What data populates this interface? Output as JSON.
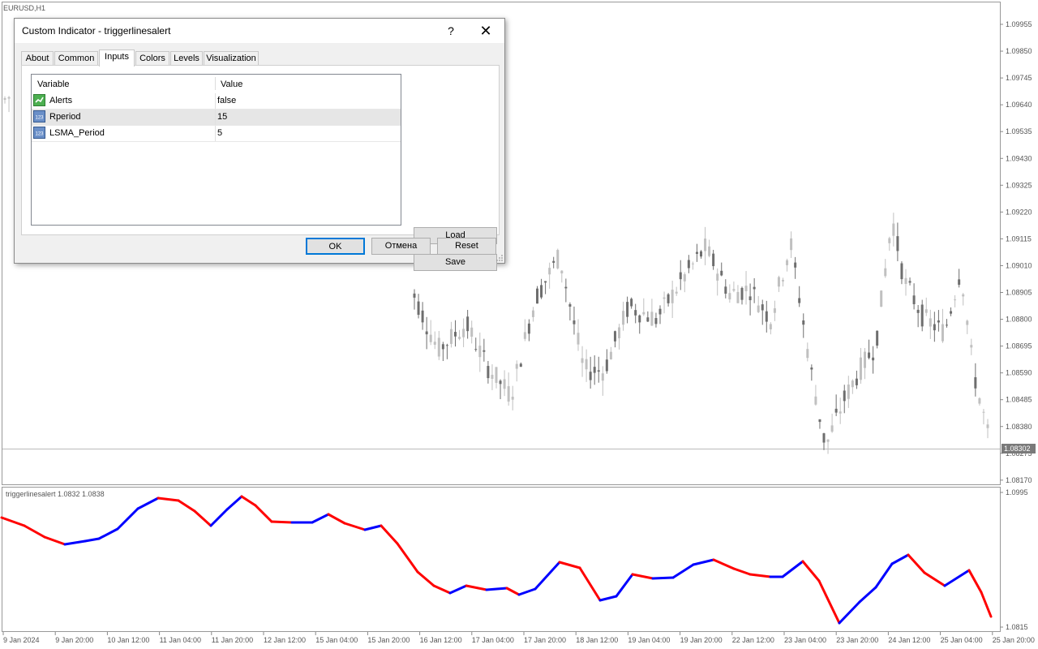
{
  "chart": {
    "symbol_label": "EURUSD,H1",
    "price_ticks": [
      "1.09955",
      "1.09850",
      "1.09745",
      "1.09640",
      "1.09535",
      "1.09430",
      "1.09325",
      "1.09220",
      "1.09115",
      "1.09010",
      "1.08905",
      "1.08800",
      "1.08695",
      "1.08590",
      "1.08485",
      "1.08380",
      "1.08275",
      "1.08170"
    ],
    "current_price": "1.08302",
    "current_price_color": "#7a7a7a",
    "indicator_label": "triggerlinesalert 1.0832 1.0838",
    "indicator_ticks": [
      "1.0995",
      "1.0815"
    ],
    "time_labels": [
      "9 Jan 2024",
      "9 Jan 20:00",
      "10 Jan 12:00",
      "11 Jan 04:00",
      "11 Jan 20:00",
      "12 Jan 12:00",
      "15 Jan 04:00",
      "15 Jan 20:00",
      "16 Jan 12:00",
      "17 Jan 04:00",
      "17 Jan 20:00",
      "18 Jan 12:00",
      "19 Jan 04:00",
      "19 Jan 20:00",
      "22 Jan 12:00",
      "23 Jan 04:00",
      "23 Jan 20:00",
      "24 Jan 12:00",
      "25 Jan 04:00",
      "25 Jan 20:00"
    ],
    "colors": {
      "bull": "#c0c0c0",
      "bear": "#6e6e6e",
      "line_up": "#0000ff",
      "line_down": "#ff0000"
    }
  },
  "dialog": {
    "title": "Custom Indicator - triggerlinesalert",
    "help_label": "?",
    "close_label": "✕",
    "tabs": [
      {
        "label": "About"
      },
      {
        "label": "Common"
      },
      {
        "label": "Inputs"
      },
      {
        "label": "Colors"
      },
      {
        "label": "Levels"
      },
      {
        "label": "Visualization"
      }
    ],
    "active_tab": "Inputs",
    "grid": {
      "col_variable": "Variable",
      "col_value": "Value",
      "rows": [
        {
          "name": "Alerts",
          "value": "false",
          "icon": "toggle-icon"
        },
        {
          "name": "Rperiod",
          "value": "15",
          "icon": "number-icon"
        },
        {
          "name": "LSMA_Period",
          "value": "5",
          "icon": "number-icon"
        }
      ]
    },
    "buttons": {
      "load": "Load",
      "save": "Save",
      "ok": "OK",
      "cancel": "Отмена",
      "reset": "Reset"
    }
  }
}
